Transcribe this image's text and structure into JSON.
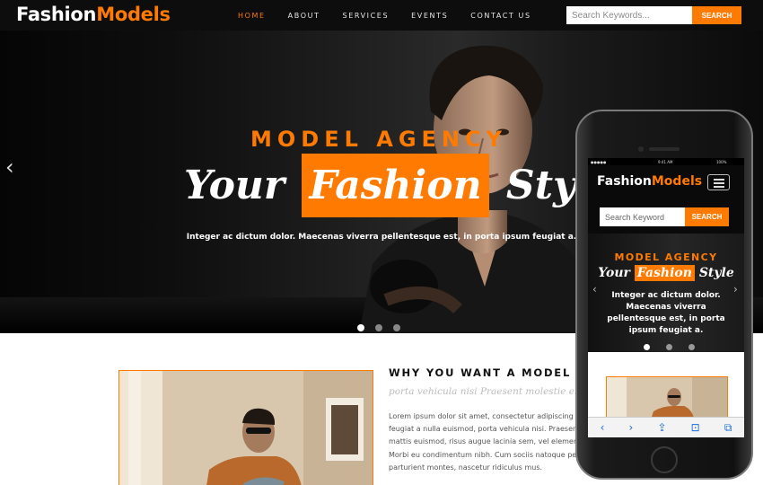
{
  "header": {
    "logo_part1": "Fashion",
    "logo_part2": "Models",
    "nav": [
      "HOME",
      "ABOUT",
      "SERVICES",
      "EVENTS",
      "CONTACT US"
    ],
    "search_placeholder": "Search Keywords...",
    "search_button": "SEARCH"
  },
  "hero": {
    "kicker": "MODEL AGENCY",
    "title_pre": "Your",
    "title_highlight": "Fashion",
    "title_post": "Style",
    "subtitle": "Integer ac dictum dolor. Maecenas viverra pellentesque est, in porta ipsum feugiat a.",
    "prev_arrow": "‹",
    "active_slide": 1,
    "slide_count": 3
  },
  "about": {
    "heading": "WHY YOU WANT A MODEL ?",
    "tagline": "porta vehicula nisi Praesent molestie elit.",
    "body": "Lorem ipsum dolor sit amet, consectetur adipiscing elit.\nfeugiat a nulla euismod, porta vehicula nisi. Praesent m\nmattis euismod, risus augue lacinia sem, vel elementum\nMorbi eu condimentum nibh. Cum sociis natoque penatib\nparturient montes, nascetur ridiculus mus."
  },
  "mobile": {
    "status_time": "9:41 AM",
    "status_battery": "100%",
    "logo_part1": "Fashion",
    "logo_part2": "Models",
    "search_placeholder": "Search Keyword",
    "search_button": "SEARCH",
    "kicker": "MODEL AGENCY",
    "title_pre": "Your",
    "title_highlight": "Fashion",
    "title_post": "Style",
    "subtitle": "Integer ac dictum dolor. Maecenas viverra pellentesque est, in porta ipsum feugiat a.",
    "prev_arrow": "‹",
    "next_arrow": "›",
    "toolbar": [
      "‹",
      "›",
      "⇪",
      "⊡",
      "⧉"
    ]
  },
  "colors": {
    "accent": "#ff7a00",
    "header_bg": "#0d0d0d"
  }
}
